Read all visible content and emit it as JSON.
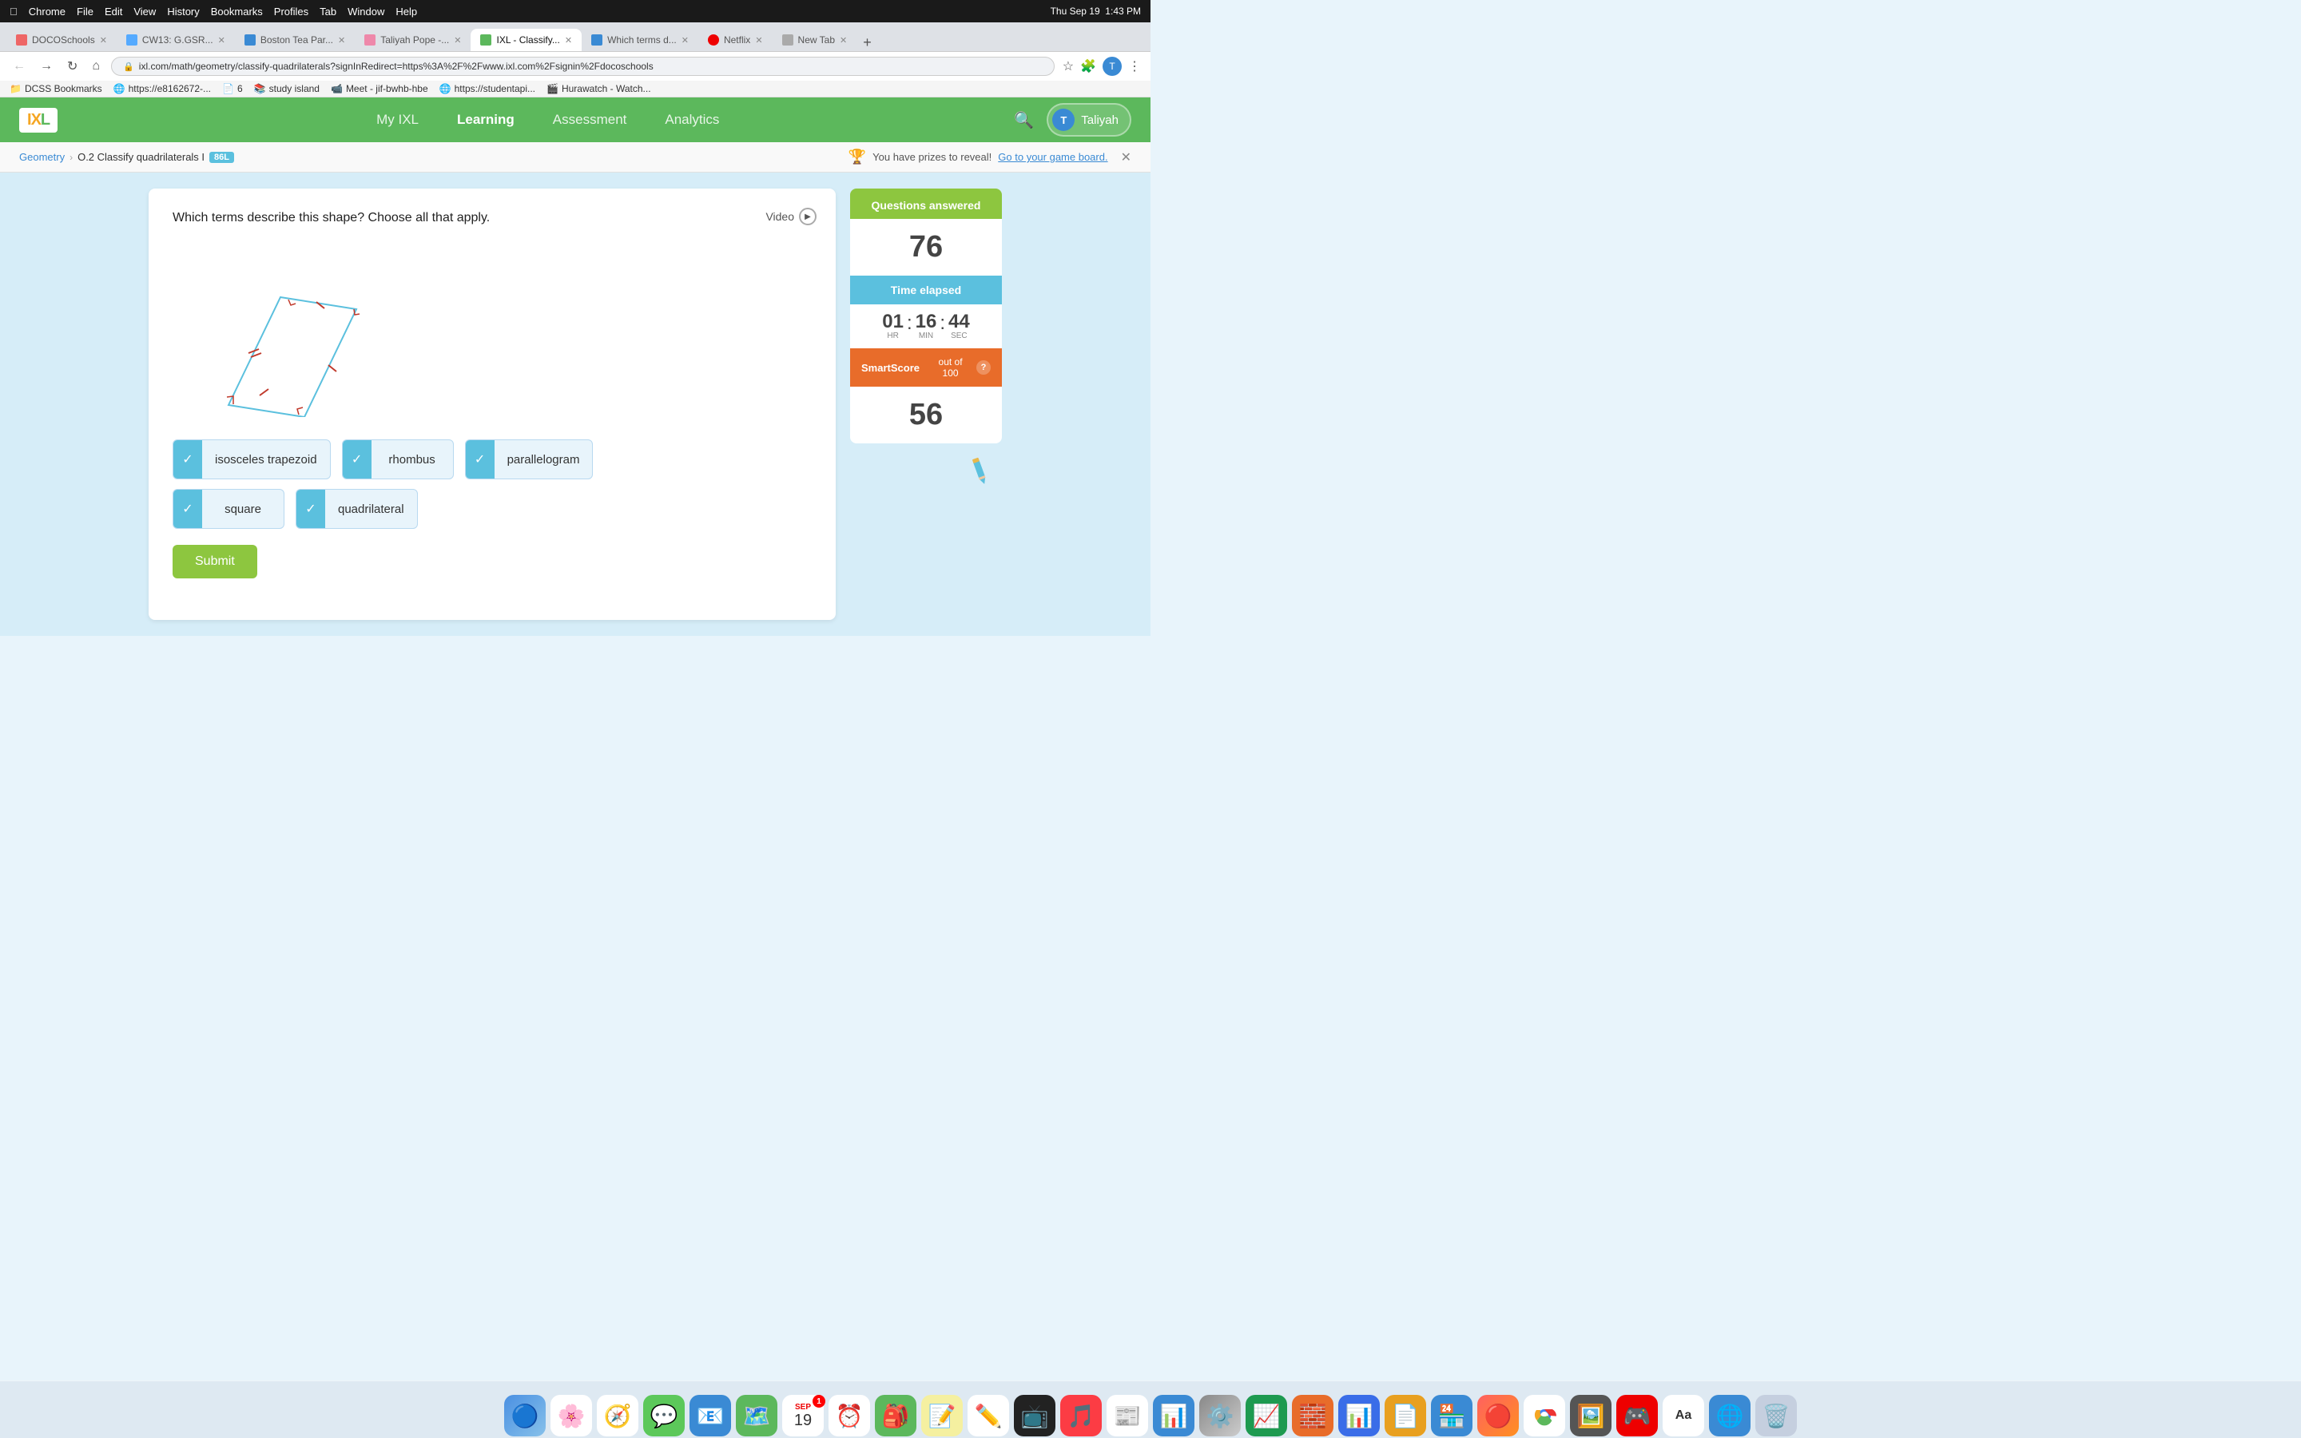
{
  "macbar": {
    "apple": "&#63743;",
    "menus": [
      "Chrome",
      "File",
      "Edit",
      "View",
      "History",
      "Bookmarks",
      "Profiles",
      "Tab",
      "Window",
      "Help"
    ],
    "right": [
      "Thu Sep 19",
      "1:43 PM"
    ]
  },
  "tabs": [
    {
      "label": "DOCOSchools",
      "favicon_color": "#e66",
      "active": false
    },
    {
      "label": "CW13: G.GSR...",
      "favicon_color": "#5af",
      "active": false
    },
    {
      "label": "Boston Tea Par...",
      "favicon_color": "#3a8ad4",
      "active": false
    },
    {
      "label": "Taliyah Pope -...",
      "favicon_color": "#e8a",
      "active": false
    },
    {
      "label": "IXL - Classify...",
      "favicon_color": "#5cb85c",
      "active": true
    },
    {
      "label": "Which terms d...",
      "favicon_color": "#3a8ad4",
      "active": false
    },
    {
      "label": "Netflix",
      "favicon_color": "#e00",
      "active": false
    },
    {
      "label": "New Tab",
      "favicon_color": "#aaa",
      "active": false
    }
  ],
  "urlbar": {
    "url": "ixl.com/math/geometry/classify-quadrilaterals?signInRedirect=https%3A%2F%2Fwww.ixl.com%2Fsignin%2Fdocoschools"
  },
  "bookmarks": [
    {
      "label": "DCSS Bookmarks"
    },
    {
      "label": "https://e8162672-..."
    },
    {
      "label": "6"
    },
    {
      "label": "study island"
    },
    {
      "label": "Meet - jif-bwhb-hbe"
    },
    {
      "label": "https://studentapi..."
    },
    {
      "label": "Hurawatch - Watch..."
    }
  ],
  "nav": {
    "logo": "IXL",
    "links": [
      {
        "label": "My IXL",
        "active": false
      },
      {
        "label": "Learning",
        "active": true
      },
      {
        "label": "Assessment",
        "active": false
      },
      {
        "label": "Analytics",
        "active": false
      }
    ],
    "user": "Taliyah"
  },
  "breadcrumb": {
    "subject": "Geometry",
    "topic": "O.2 Classify quadrilaterals I",
    "level": "86L"
  },
  "prize": {
    "text": "You have prizes to reveal!",
    "link": "Go to your game board."
  },
  "question": {
    "text": "Which terms describe this shape? Choose all that apply.",
    "video_label": "Video"
  },
  "choices": [
    {
      "label": "isosceles trapezoid",
      "checked": true
    },
    {
      "label": "rhombus",
      "checked": true
    },
    {
      "label": "parallelogram",
      "checked": true
    },
    {
      "label": "square",
      "checked": true
    },
    {
      "label": "quadrilateral",
      "checked": true
    }
  ],
  "submit": {
    "label": "Submit"
  },
  "sidebar": {
    "qa_label": "Questions answered",
    "qa_count": "76",
    "time_label": "Time elapsed",
    "time_hr": "01",
    "time_min": "16",
    "time_sec": "44",
    "time_hr_lbl": "HR",
    "time_min_lbl": "MIN",
    "time_sec_lbl": "SEC",
    "smart_label": "SmartScore",
    "smart_sublabel": "out of 100",
    "smart_score": "56"
  },
  "dock": [
    {
      "emoji": "🔵",
      "label": "finder"
    },
    {
      "emoji": "🖼️",
      "label": "photos"
    },
    {
      "emoji": "🧭",
      "label": "safari"
    },
    {
      "emoji": "💬",
      "label": "messages"
    },
    {
      "emoji": "📧",
      "label": "mail"
    },
    {
      "emoji": "🗺️",
      "label": "maps"
    },
    {
      "emoji": "📅",
      "label": "calendar",
      "badge": "19"
    },
    {
      "emoji": "⌚",
      "label": "clock"
    },
    {
      "emoji": "🎒",
      "label": "app1"
    },
    {
      "emoji": "📝",
      "label": "notes"
    },
    {
      "emoji": "✏️",
      "label": "freeform"
    },
    {
      "emoji": "📺",
      "label": "appletv"
    },
    {
      "emoji": "🎵",
      "label": "music"
    },
    {
      "emoji": "📰",
      "label": "news"
    },
    {
      "emoji": "📊",
      "label": "nwea"
    },
    {
      "emoji": "🔧",
      "label": "settings"
    },
    {
      "emoji": "📈",
      "label": "numbers"
    },
    {
      "emoji": "🧱",
      "label": "app2"
    },
    {
      "emoji": "📊",
      "label": "keynote"
    },
    {
      "emoji": "📄",
      "label": "pages"
    },
    {
      "emoji": "⚙️",
      "label": "appstore"
    },
    {
      "emoji": "🔴",
      "label": "settings2"
    },
    {
      "emoji": "🌐",
      "label": "chrome"
    },
    {
      "emoji": "🖼️",
      "label": "imageview"
    },
    {
      "emoji": "🎮",
      "label": "roblox"
    },
    {
      "emoji": "Aa",
      "label": "dictionary"
    },
    {
      "emoji": "🌐",
      "label": "wifibrowser"
    },
    {
      "emoji": "🗑️",
      "label": "trash"
    }
  ]
}
